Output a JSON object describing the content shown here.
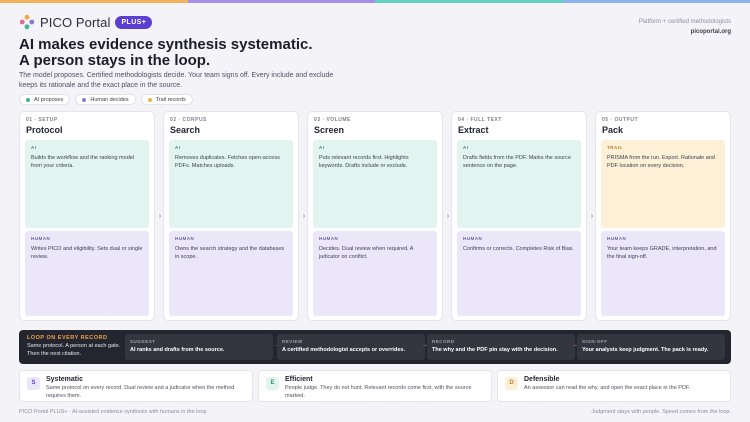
{
  "header": {
    "brand_name": "PICO Portal",
    "badge": "PLUS+",
    "top_right_line1": "Platform + certified methodologists",
    "top_right_line2": "picoportal.org",
    "headline_line1": "AI makes evidence synthesis systematic.",
    "headline_line2": "A person stays in the loop.",
    "subtext": "The model proposes. Certified methodologists decide. Your team signs off. Every include and exclude keeps its rationale and the exact place in the source.",
    "topbar_colors": [
      "#f4b35a",
      "#a98ee8",
      "#63d2c4",
      "#8cb4ee"
    ]
  },
  "legend": [
    {
      "label": "AI proposes",
      "color": "#3fb795"
    },
    {
      "label": "Human decides",
      "color": "#8b79d6"
    },
    {
      "label": "Trail records",
      "color": "#f0b53d"
    }
  ],
  "stages": [
    {
      "num": "01 · SETUP",
      "title": "Protocol",
      "top_tag": "AI",
      "top_text": "Builds the workflow and the ranking model from your criteria.",
      "human_tag": "HUMAN",
      "human_text": "Writes PICO and eligibility. Sets dual or single review."
    },
    {
      "num": "02 · CORPUS",
      "title": "Search",
      "top_tag": "AI",
      "top_text": "Removes duplicates. Fetches open-access PDFs. Matches uploads.",
      "human_tag": "HUMAN",
      "human_text": "Owns the search strategy and the databases in scope."
    },
    {
      "num": "03 · VOLUME",
      "title": "Screen",
      "top_tag": "AI",
      "top_text": "Puts relevant records first. Highlights keywords. Drafts include or exclude.",
      "human_tag": "HUMAN",
      "human_text": "Decides. Dual review when required. A judicator on conflict."
    },
    {
      "num": "04 · FULL TEXT",
      "title": "Extract",
      "top_tag": "AI",
      "top_text": "Drafts fields from the PDF. Marks the source sentence on the page.",
      "human_tag": "HUMAN",
      "human_text": "Confirms or corrects. Completes Risk of Bias."
    },
    {
      "num": "05 · OUTPUT",
      "title": "Pack",
      "top_tag": "TRAIL",
      "top_text": "PRISMA from the run. Export. Rationale and PDF location on every decision.",
      "human_tag": "HUMAN",
      "human_text": "Your team keeps GRADE, interpretation, and the final sign-off."
    }
  ],
  "stage_arrow": "›",
  "loop": {
    "title": "LOOP ON EVERY RECORD",
    "desc": "Same protocol. A person at each gate. Then the next citation.",
    "arrow": "→",
    "steps": [
      {
        "label": "SUGGEST",
        "text": "AI ranks and drafts from the source."
      },
      {
        "label": "REVIEW",
        "text": "A certified methodologist accepts or overrides."
      },
      {
        "label": "RECORD",
        "text": "The why and the PDF pin stay with the decision."
      },
      {
        "label": "SIGN-OFF",
        "text": "Your analysts keep judgment. The pack is ready."
      }
    ]
  },
  "benefits": [
    {
      "icon": "S",
      "title": "Systematic",
      "text": "Same protocol on every record. Dual review and a judicator when the method requires them.",
      "icon_bg": "#ebe7f8",
      "icon_color": "#5b3fd0"
    },
    {
      "icon": "E",
      "title": "Efficient",
      "text": "People judge. They do not hunt. Relevant records come first, with the source marked.",
      "icon_bg": "#e2f4ef",
      "icon_color": "#2f8f75"
    },
    {
      "icon": "D",
      "title": "Defensible",
      "text": "An assessor can read the why, and open the exact place in the PDF.",
      "icon_bg": "#fdf0d7",
      "icon_color": "#c0812a"
    }
  ],
  "footer": {
    "left": "PICO Portal PLUS+ · AI-assisted evidence synthesis with humans in the loop",
    "right": "Judgment stays with people. Speed comes from the loop."
  }
}
